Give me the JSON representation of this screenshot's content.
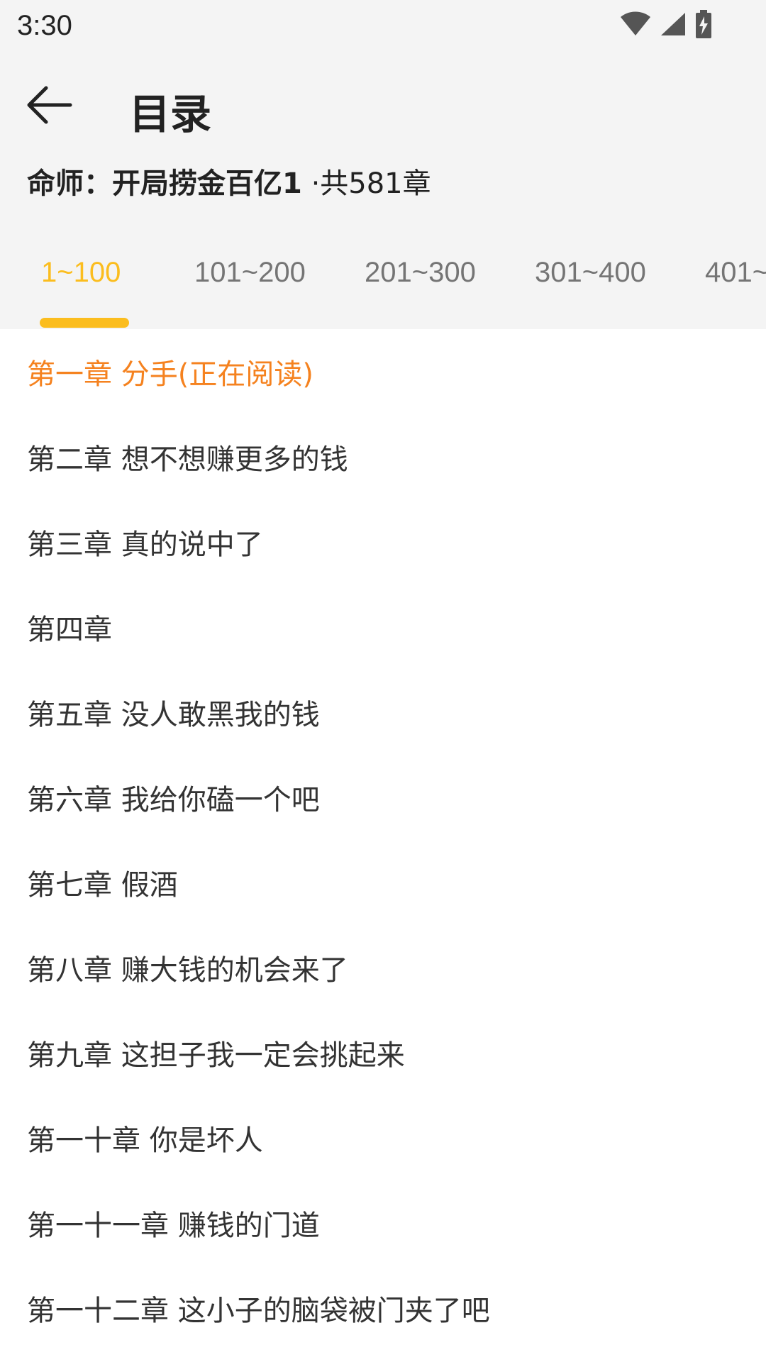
{
  "status_bar": {
    "time": "3:30",
    "icons": [
      "wifi-icon",
      "cell-signal-icon",
      "battery-charging-icon"
    ]
  },
  "header": {
    "title": "目录",
    "back_icon": "back-arrow-icon"
  },
  "book": {
    "title": "命师：开局捞金百亿1",
    "chapter_count": "·共581章"
  },
  "range_tabs": [
    {
      "label": "1~100",
      "active": true
    },
    {
      "label": "101~200",
      "active": false
    },
    {
      "label": "201~300",
      "active": false
    },
    {
      "label": "301~400",
      "active": false
    },
    {
      "label": "401~",
      "active": false
    }
  ],
  "chapters": [
    {
      "label": "第一章 分手(正在阅读)",
      "current": true
    },
    {
      "label": "第二章 想不想赚更多的钱"
    },
    {
      "label": "第三章 真的说中了"
    },
    {
      "label": "第四章"
    },
    {
      "label": "第五章 没人敢黑我的钱"
    },
    {
      "label": "第六章 我给你磕一个吧"
    },
    {
      "label": "第七章 假酒"
    },
    {
      "label": "第八章 赚大钱的机会来了"
    },
    {
      "label": "第九章 这担子我一定会挑起来"
    },
    {
      "label": "第一十章 你是坏人"
    },
    {
      "label": "第一十一章 赚钱的门道"
    },
    {
      "label": "第一十二章 这小子的脑袋被门夹了吧"
    }
  ],
  "colors": {
    "accent_yellow": "#fbbd1e",
    "current_chapter_orange": "#f5821f",
    "header_background": "#f4f4f4",
    "list_background": "#ffffff"
  }
}
